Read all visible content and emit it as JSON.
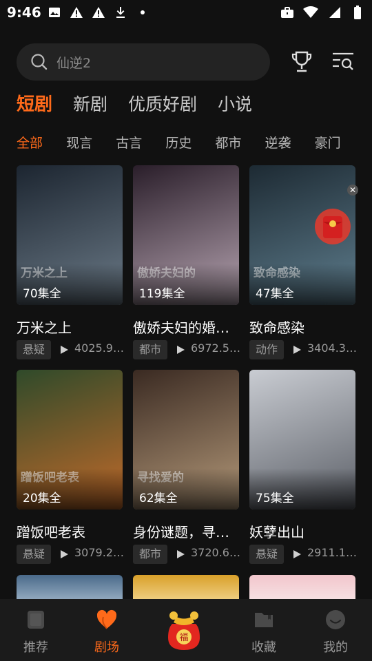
{
  "status_bar": {
    "time": "9:46"
  },
  "search": {
    "placeholder": "仙逆2"
  },
  "main_tabs": [
    {
      "label": "短剧",
      "active": true
    },
    {
      "label": "新剧",
      "active": false
    },
    {
      "label": "优质好剧",
      "active": false
    },
    {
      "label": "小说",
      "active": false
    }
  ],
  "categories": [
    {
      "label": "全部",
      "active": true
    },
    {
      "label": "现言"
    },
    {
      "label": "古言"
    },
    {
      "label": "历史"
    },
    {
      "label": "都市"
    },
    {
      "label": "逆袭"
    },
    {
      "label": "豪门"
    }
  ],
  "dramas": [
    {
      "title": "万米之上",
      "episodes": "70集全",
      "genre": "悬疑",
      "views": "4025.9…",
      "poster_text": "万米之上",
      "colors": [
        "#1c2530",
        "#6c7b88"
      ]
    },
    {
      "title": "傲娇夫妇的婚后…",
      "episodes": "119集全",
      "genre": "都市",
      "views": "6972.5…",
      "poster_text": "傲娇夫妇的",
      "colors": [
        "#2a1e2a",
        "#b7a5b2"
      ]
    },
    {
      "title": "致命感染",
      "episodes": "47集全",
      "genre": "动作",
      "views": "3404.3…",
      "poster_text": "致命感染",
      "colors": [
        "#1d2a33",
        "#5f7e8e"
      ]
    },
    {
      "title": "蹭饭吧老表",
      "episodes": "20集全",
      "genre": "悬疑",
      "views": "3079.2…",
      "poster_text": "蹭饭吧老表",
      "colors": [
        "#2f4a2a",
        "#c26a2a"
      ]
    },
    {
      "title": "身份谜题，寻找…",
      "episodes": "62集全",
      "genre": "都市",
      "views": "3720.6…",
      "poster_text": "寻找爱的",
      "colors": [
        "#3a2a22",
        "#b59a7a"
      ]
    },
    {
      "title": "妖孽出山",
      "episodes": "75集全",
      "genre": "悬疑",
      "views": "2911.1…",
      "poster_text": "",
      "colors": [
        "#c9ccd2",
        "#5a5e66"
      ]
    }
  ],
  "bottom_nav": [
    {
      "label": "推荐",
      "icon": "recommend-icon",
      "active": false
    },
    {
      "label": "剧场",
      "icon": "theater-heart-icon",
      "active": true
    },
    {
      "label": "收藏",
      "icon": "folder-icon",
      "active": false
    },
    {
      "label": "我的",
      "icon": "profile-icon",
      "active": false
    }
  ],
  "accent_color": "#ff6a1a"
}
